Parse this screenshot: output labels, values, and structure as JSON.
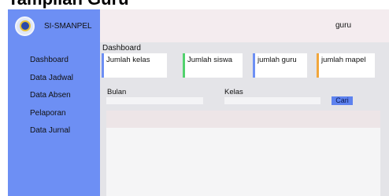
{
  "page": {
    "heading": "Tampilan Guru"
  },
  "sidebar": {
    "brand": "SI-SMANPEL",
    "items": [
      {
        "label": "Dashboard"
      },
      {
        "label": "Data Jadwal"
      },
      {
        "label": "Data Absen"
      },
      {
        "label": "Pelaporan"
      },
      {
        "label": "Data Jurnal"
      }
    ]
  },
  "topbar": {
    "user": "guru"
  },
  "main": {
    "section_title": "Dashboard",
    "cards": [
      {
        "label": "Jumlah kelas",
        "accent": "#6d8ff4"
      },
      {
        "label": "Jumlah siswa",
        "accent": "#52d26d"
      },
      {
        "label": "jumlah guru",
        "accent": "#6d8ff4"
      },
      {
        "label": "jumlah mapel",
        "accent": "#f1a63b"
      }
    ],
    "filter": {
      "month_label": "Bulan",
      "month_value": "",
      "class_label": "Kelas",
      "class_value": "",
      "search_label": "Cari"
    }
  },
  "colors": {
    "sidebar": "#6d8ff4",
    "topbar": "#f4ecef",
    "content_bg": "#e4e4e8",
    "button": "#5d82ef"
  }
}
